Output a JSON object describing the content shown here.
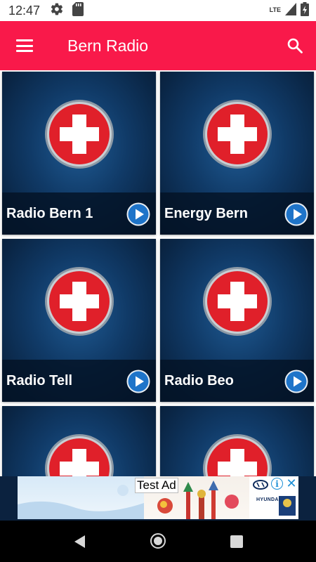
{
  "status_bar": {
    "time": "12:47",
    "network": "LTE",
    "icons": [
      "settings-gear-icon",
      "sd-card-icon",
      "signal-icon",
      "battery-icon"
    ]
  },
  "app_bar": {
    "title": "Bern Radio",
    "background_color": "#f9194a",
    "menu_icon": "hamburger-menu-icon",
    "search_icon": "search-icon"
  },
  "stations": [
    {
      "name": "Radio Bern 1"
    },
    {
      "name": "Energy Bern"
    },
    {
      "name": "Radio Tell"
    },
    {
      "name": "Radio Beo"
    },
    {
      "name": ""
    },
    {
      "name": ""
    }
  ],
  "ad": {
    "label": "Test Ad",
    "brand": "HYUNDAI",
    "info_icon": "info-icon",
    "close_icon": "close-icon"
  },
  "nav_bar": {
    "icons": [
      "back-icon",
      "home-icon",
      "recents-icon"
    ]
  }
}
